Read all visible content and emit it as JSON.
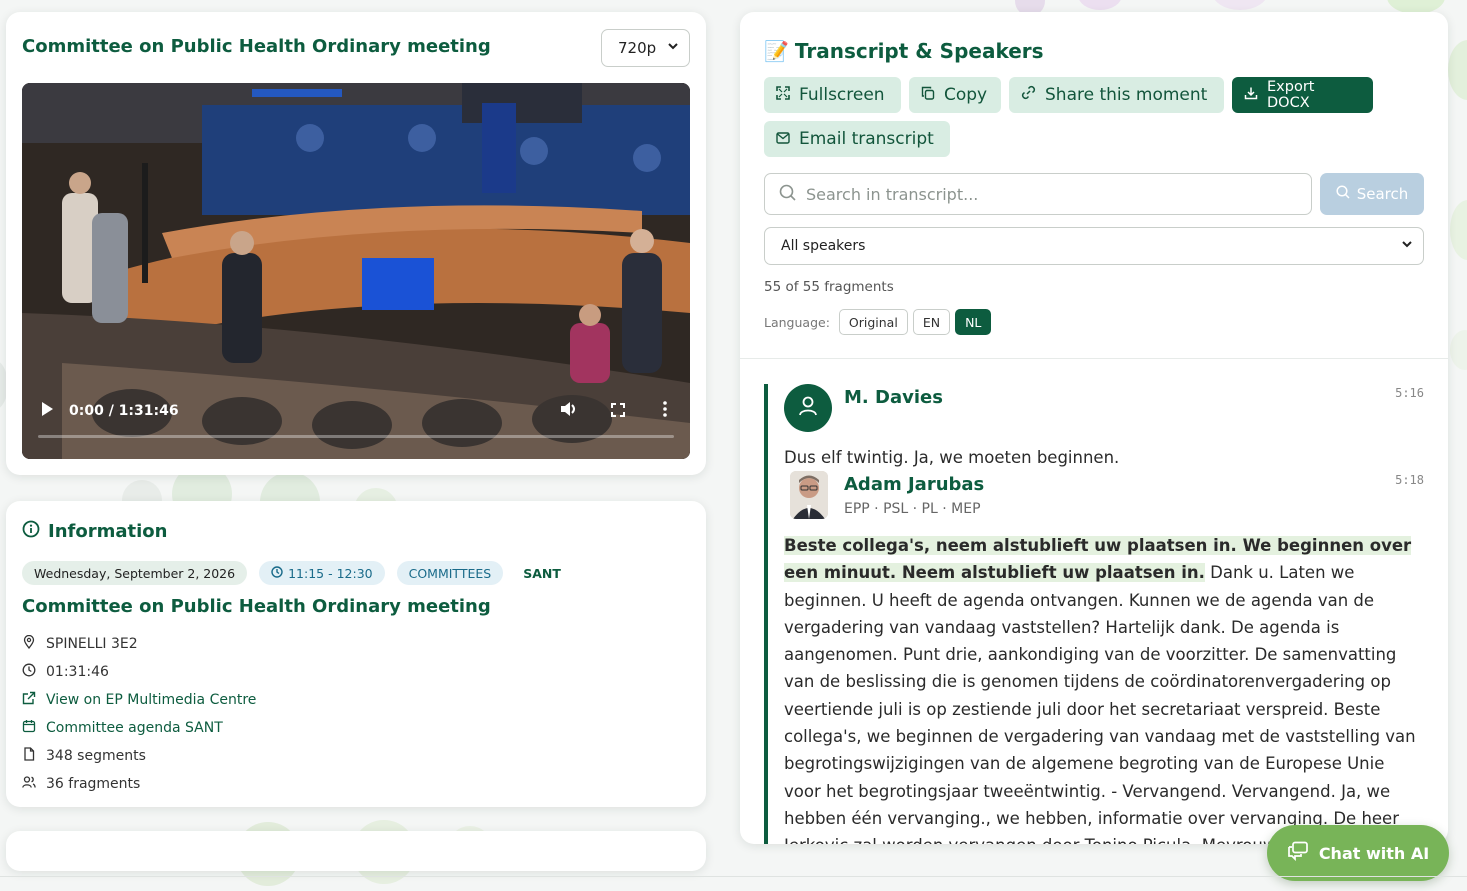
{
  "video": {
    "title": "Committee on Public Health Ordinary meeting",
    "quality": "720p",
    "time_display": "0:00 / 1:31:46",
    "progress_fraction": 0
  },
  "info": {
    "heading": "Information",
    "date": "Wednesday, September 2, 2026",
    "time_range": "11:15 - 12:30",
    "type": "COMMITTEES",
    "code": "SANT",
    "title": "Committee on Public Health Ordinary meeting",
    "room": "SPINELLI 3E2",
    "duration": "01:31:46",
    "multimedia_link": "View on EP Multimedia Centre",
    "agenda_link": "Committee agenda SANT",
    "segments": "348 segments",
    "fragments": "36 fragments"
  },
  "transcript": {
    "title": "Transcript & Speakers",
    "title_emoji": "📝",
    "buttons": {
      "fullscreen": "Fullscreen",
      "copy": "Copy",
      "share": "Share this moment",
      "export": "Export DOCX",
      "email": "Email transcript"
    },
    "search_placeholder": "Search in transcript...",
    "search_button": "Search",
    "speaker_filter": "All speakers",
    "fragment_count": "55 of 55 fragments",
    "language_label": "Language:",
    "languages": [
      "Original",
      "EN",
      "NL"
    ],
    "active_language": "NL",
    "entries": [
      {
        "speaker": "M. Davies",
        "timestamp": "5:16",
        "text": "Dus elf twintig. Ja, we moeten beginnen."
      },
      {
        "speaker": "Adam Jarubas",
        "affiliation": "EPP · PSL · PL · MEP",
        "timestamp": "5:18",
        "highlight": "Beste collega's, neem alstublieft uw plaatsen in. We beginnen over een minuut. Neem alstublieft uw plaatsen in.",
        "text": " Dank u. Laten we beginnen. U heeft de agenda ontvangen. Kunnen we de agenda van de vergadering van vandaag vaststellen? Hartelijk dank. De agenda is aangenomen. Punt drie, aankondiging van de voorzitter. De samenvatting van de beslissing die is genomen tijdens de coördinatorenvergadering op veertiende juli is op zestiende juli door het secretariaat verspreid. Beste collega's, we beginnen de vergadering van vandaag met de vaststelling van begrotingswijzigingen van de algemene begroting van de Europese Unie voor het begrotingsjaar tweeëntwintig. - Vervangend. Vervangend. Ja, we hebben één vervanging., we hebben, informatie over vervanging. De heer Jerkovic zal worden vervangen door Tonino Picula. Mevrouw"
      }
    ]
  },
  "chat": {
    "label": "Chat with AI"
  },
  "colors": {
    "accent": "#0d5c3f",
    "accent_soft": "#d9ede3",
    "chat": "#78b458"
  }
}
